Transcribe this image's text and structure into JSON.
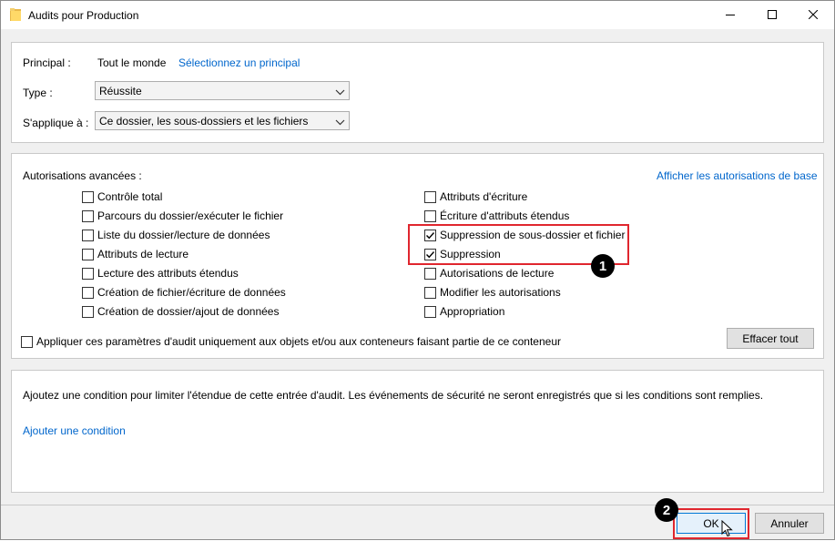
{
  "window": {
    "title": "Audits pour Production",
    "icon": "folder-icon",
    "controls": [
      "minimize-icon",
      "maximize-icon",
      "close-icon"
    ]
  },
  "principal": {
    "label": "Principal :",
    "value": "Tout le monde",
    "select_link": "Sélectionnez un principal"
  },
  "type": {
    "label": "Type :",
    "value": "Réussite"
  },
  "applies_to": {
    "label": "S'applique à :",
    "value": "Ce dossier, les sous-dossiers et les fichiers"
  },
  "permissions": {
    "heading": "Autorisations avancées :",
    "basic_link": "Afficher les autorisations de base",
    "left": [
      {
        "label": "Contrôle total",
        "checked": false
      },
      {
        "label": "Parcours du dossier/exécuter le fichier",
        "checked": false
      },
      {
        "label": "Liste du dossier/lecture de données",
        "checked": false
      },
      {
        "label": "Attributs de lecture",
        "checked": false
      },
      {
        "label": "Lecture des attributs étendus",
        "checked": false
      },
      {
        "label": "Création de fichier/écriture de données",
        "checked": false
      },
      {
        "label": "Création de dossier/ajout de données",
        "checked": false
      }
    ],
    "right": [
      {
        "label": "Attributs d'écriture",
        "checked": false
      },
      {
        "label": "Écriture d'attributs étendus",
        "checked": false
      },
      {
        "label": "Suppression de sous-dossier et fichier",
        "checked": true
      },
      {
        "label": "Suppression",
        "checked": true
      },
      {
        "label": "Autorisations de lecture",
        "checked": false
      },
      {
        "label": "Modifier les autorisations",
        "checked": false
      },
      {
        "label": "Appropriation",
        "checked": false
      }
    ],
    "apply_only": {
      "label": "Appliquer ces paramètres d'audit uniquement aux objets et/ou aux conteneurs faisant partie de ce conteneur",
      "checked": false
    },
    "clear_all": "Effacer tout"
  },
  "condition": {
    "description": "Ajoutez une condition pour limiter l'étendue de cette entrée d'audit. Les événements de sécurité ne seront enregistrés que si les conditions sont remplies.",
    "add_link": "Ajouter une condition"
  },
  "footer": {
    "ok": "OK",
    "cancel": "Annuler"
  },
  "annotations": {
    "badge1": "1",
    "badge2": "2",
    "highlight_color": "#e0262e"
  },
  "colors": {
    "link": "#0066cc",
    "default_button_border": "#0078d7"
  }
}
